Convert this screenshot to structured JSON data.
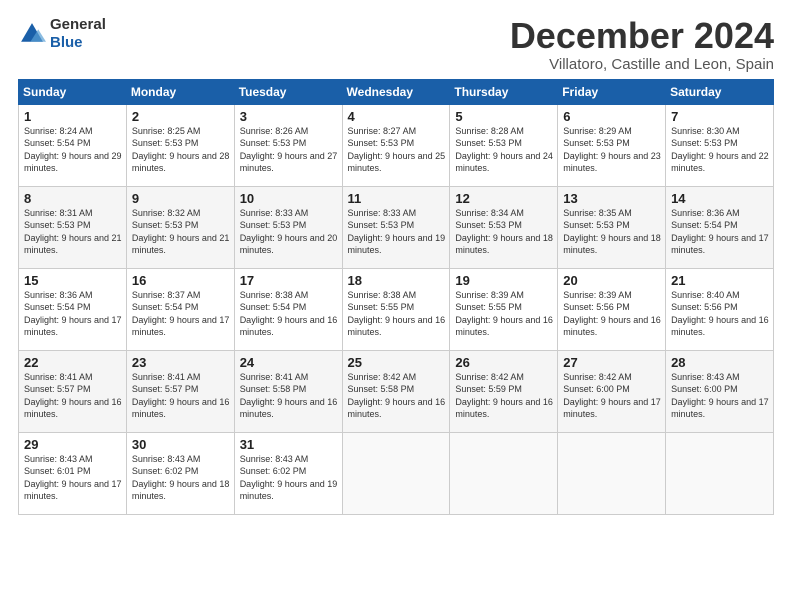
{
  "logo": {
    "line1": "General",
    "line2": "Blue"
  },
  "title": "December 2024",
  "location": "Villatoro, Castille and Leon, Spain",
  "days_of_week": [
    "Sunday",
    "Monday",
    "Tuesday",
    "Wednesday",
    "Thursday",
    "Friday",
    "Saturday"
  ],
  "weeks": [
    [
      {
        "day": "1",
        "sunrise": "8:24 AM",
        "sunset": "5:54 PM",
        "daylight": "9 hours and 29 minutes."
      },
      {
        "day": "2",
        "sunrise": "8:25 AM",
        "sunset": "5:53 PM",
        "daylight": "9 hours and 28 minutes."
      },
      {
        "day": "3",
        "sunrise": "8:26 AM",
        "sunset": "5:53 PM",
        "daylight": "9 hours and 27 minutes."
      },
      {
        "day": "4",
        "sunrise": "8:27 AM",
        "sunset": "5:53 PM",
        "daylight": "9 hours and 25 minutes."
      },
      {
        "day": "5",
        "sunrise": "8:28 AM",
        "sunset": "5:53 PM",
        "daylight": "9 hours and 24 minutes."
      },
      {
        "day": "6",
        "sunrise": "8:29 AM",
        "sunset": "5:53 PM",
        "daylight": "9 hours and 23 minutes."
      },
      {
        "day": "7",
        "sunrise": "8:30 AM",
        "sunset": "5:53 PM",
        "daylight": "9 hours and 22 minutes."
      }
    ],
    [
      {
        "day": "8",
        "sunrise": "8:31 AM",
        "sunset": "5:53 PM",
        "daylight": "9 hours and 21 minutes."
      },
      {
        "day": "9",
        "sunrise": "8:32 AM",
        "sunset": "5:53 PM",
        "daylight": "9 hours and 21 minutes."
      },
      {
        "day": "10",
        "sunrise": "8:33 AM",
        "sunset": "5:53 PM",
        "daylight": "9 hours and 20 minutes."
      },
      {
        "day": "11",
        "sunrise": "8:33 AM",
        "sunset": "5:53 PM",
        "daylight": "9 hours and 19 minutes."
      },
      {
        "day": "12",
        "sunrise": "8:34 AM",
        "sunset": "5:53 PM",
        "daylight": "9 hours and 18 minutes."
      },
      {
        "day": "13",
        "sunrise": "8:35 AM",
        "sunset": "5:53 PM",
        "daylight": "9 hours and 18 minutes."
      },
      {
        "day": "14",
        "sunrise": "8:36 AM",
        "sunset": "5:54 PM",
        "daylight": "9 hours and 17 minutes."
      }
    ],
    [
      {
        "day": "15",
        "sunrise": "8:36 AM",
        "sunset": "5:54 PM",
        "daylight": "9 hours and 17 minutes."
      },
      {
        "day": "16",
        "sunrise": "8:37 AM",
        "sunset": "5:54 PM",
        "daylight": "9 hours and 17 minutes."
      },
      {
        "day": "17",
        "sunrise": "8:38 AM",
        "sunset": "5:54 PM",
        "daylight": "9 hours and 16 minutes."
      },
      {
        "day": "18",
        "sunrise": "8:38 AM",
        "sunset": "5:55 PM",
        "daylight": "9 hours and 16 minutes."
      },
      {
        "day": "19",
        "sunrise": "8:39 AM",
        "sunset": "5:55 PM",
        "daylight": "9 hours and 16 minutes."
      },
      {
        "day": "20",
        "sunrise": "8:39 AM",
        "sunset": "5:56 PM",
        "daylight": "9 hours and 16 minutes."
      },
      {
        "day": "21",
        "sunrise": "8:40 AM",
        "sunset": "5:56 PM",
        "daylight": "9 hours and 16 minutes."
      }
    ],
    [
      {
        "day": "22",
        "sunrise": "8:41 AM",
        "sunset": "5:57 PM",
        "daylight": "9 hours and 16 minutes."
      },
      {
        "day": "23",
        "sunrise": "8:41 AM",
        "sunset": "5:57 PM",
        "daylight": "9 hours and 16 minutes."
      },
      {
        "day": "24",
        "sunrise": "8:41 AM",
        "sunset": "5:58 PM",
        "daylight": "9 hours and 16 minutes."
      },
      {
        "day": "25",
        "sunrise": "8:42 AM",
        "sunset": "5:58 PM",
        "daylight": "9 hours and 16 minutes."
      },
      {
        "day": "26",
        "sunrise": "8:42 AM",
        "sunset": "5:59 PM",
        "daylight": "9 hours and 16 minutes."
      },
      {
        "day": "27",
        "sunrise": "8:42 AM",
        "sunset": "6:00 PM",
        "daylight": "9 hours and 17 minutes."
      },
      {
        "day": "28",
        "sunrise": "8:43 AM",
        "sunset": "6:00 PM",
        "daylight": "9 hours and 17 minutes."
      }
    ],
    [
      {
        "day": "29",
        "sunrise": "8:43 AM",
        "sunset": "6:01 PM",
        "daylight": "9 hours and 17 minutes."
      },
      {
        "day": "30",
        "sunrise": "8:43 AM",
        "sunset": "6:02 PM",
        "daylight": "9 hours and 18 minutes."
      },
      {
        "day": "31",
        "sunrise": "8:43 AM",
        "sunset": "6:02 PM",
        "daylight": "9 hours and 19 minutes."
      },
      null,
      null,
      null,
      null
    ]
  ]
}
